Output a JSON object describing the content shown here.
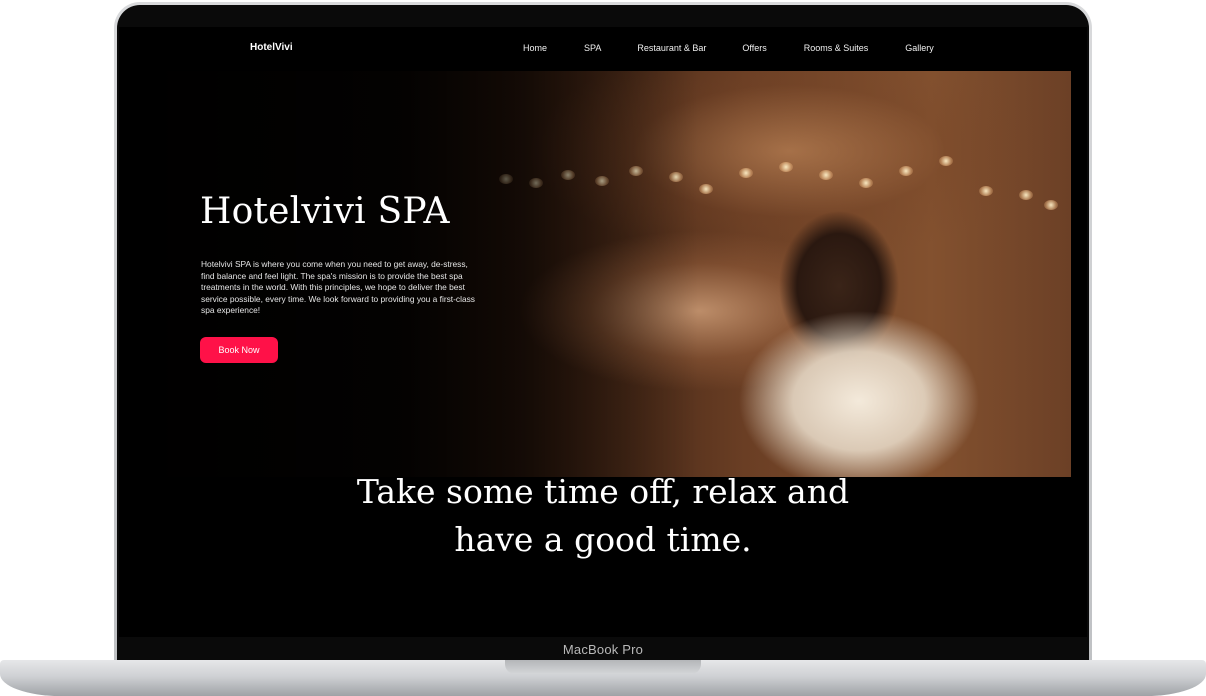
{
  "device": {
    "label": "MacBook Pro"
  },
  "site": {
    "brand": "HotelVivi",
    "nav": [
      {
        "label": "Home"
      },
      {
        "label": "SPA"
      },
      {
        "label": "Restaurant & Bar"
      },
      {
        "label": "Offers"
      },
      {
        "label": "Rooms & Suites"
      },
      {
        "label": "Gallery"
      }
    ]
  },
  "hero": {
    "title": "Hotelvivi SPA",
    "description": "Hotelvivi SPA is where you come when you need to get away, de-stress, find balance and feel light. The spa's mission is to provide the best spa treatments in the world. With this principles, we hope to deliver the best service possible, every time. We look forward to providing you a first-class spa experience!",
    "button_label": "Book Now",
    "accent_color": "#ff1148",
    "image_icon": "spa-massage-photo"
  },
  "tagline": {
    "line1": "Take some time off, relax and",
    "line2": "have a good time."
  }
}
